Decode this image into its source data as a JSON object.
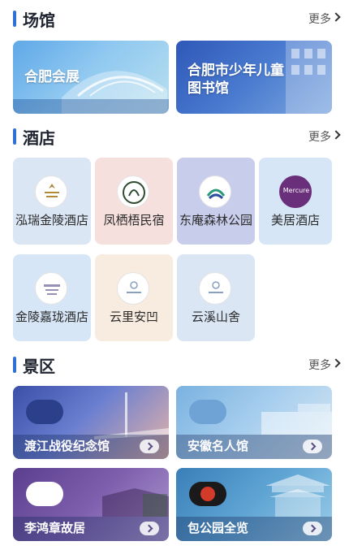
{
  "sections": {
    "venues": {
      "title": "场馆",
      "more": "更多"
    },
    "hotels": {
      "title": "酒店",
      "more": "更多"
    },
    "scenic": {
      "title": "景区",
      "more": "更多"
    }
  },
  "venues": [
    {
      "name": "合肥会展"
    },
    {
      "name": "合肥市少年儿童图书馆"
    }
  ],
  "hotels": [
    {
      "name": "泓瑞金陵酒店"
    },
    {
      "name": "凤栖梧民宿"
    },
    {
      "name": "东庵森林公园"
    },
    {
      "name": "美居酒店",
      "logo_text": "Mercure"
    },
    {
      "name": "金陵嘉珑酒店"
    },
    {
      "name": "云里安凹"
    },
    {
      "name": "云溪山舍"
    }
  ],
  "scenic": [
    {
      "name": "渡江战役纪念馆"
    },
    {
      "name": "安徽名人馆"
    },
    {
      "name": "李鸿章故居"
    },
    {
      "name": "包公园全览"
    }
  ],
  "colors": {
    "accent": "#2f6fd6",
    "hotel_blue": "#dbe6f5",
    "hotel_pink": "#f6e0dd",
    "hotel_lavender": "#c9cdec",
    "hotel_sky": "#d6e6f6",
    "hotel_peach": "#f8ece0"
  }
}
